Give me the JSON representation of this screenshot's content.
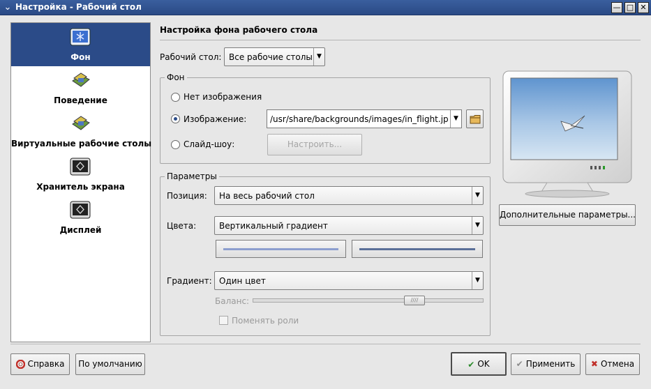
{
  "window": {
    "title": "Настройка - Рабочий стол"
  },
  "sidebar": {
    "items": [
      {
        "label": "Фон",
        "icon": "desktop-background-icon"
      },
      {
        "label": "Поведение",
        "icon": "behavior-icon"
      },
      {
        "label": "Виртуальные рабочие столы",
        "icon": "virtual-desktops-icon"
      },
      {
        "label": "Хранитель экрана",
        "icon": "screensaver-icon"
      },
      {
        "label": "Дисплей",
        "icon": "display-icon"
      }
    ],
    "selected_index": 0
  },
  "main": {
    "title": "Настройка фона рабочего стола",
    "desktop_label": "Рабочий стол:",
    "desktop_value": "Все рабочие столы",
    "background_group": {
      "title": "Фон",
      "no_image_label": "Нет изображения",
      "image_label": "Изображение:",
      "image_path": "/usr/share/backgrounds/images/in_flight.jpg",
      "slideshow_label": "Слайд-шоу:",
      "configure_label": "Настроить...",
      "selected": "image"
    },
    "params_group": {
      "title": "Параметры",
      "position_label": "Позиция:",
      "position_value": "На весь рабочий стол",
      "colors_label": "Цвета:",
      "colors_value": "Вертикальный градиент",
      "color1": "#8c9ecf",
      "color2": "#5a6f98",
      "gradient_label": "Градиент:",
      "gradient_value": "Один цвет",
      "balance_label": "Баланс:",
      "balance_level": 0.72,
      "swap_label": "Поменять роли"
    },
    "advanced_label": "Дополнительные параметры..."
  },
  "buttons": {
    "help": "Справка",
    "defaults": "По умолчанию",
    "ok": "OK",
    "apply": "Применить",
    "cancel": "Отмена"
  },
  "colors": {
    "titlebar": "#2a4a85",
    "selection": "#2b4b88",
    "window_bg": "#e7e7e7"
  }
}
